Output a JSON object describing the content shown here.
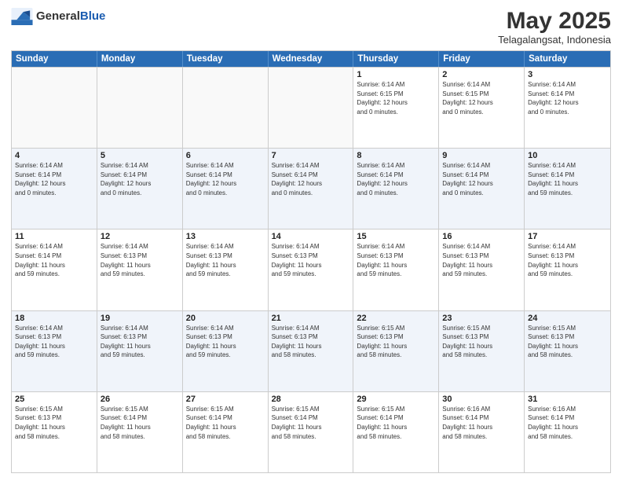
{
  "header": {
    "logo_general": "General",
    "logo_blue": "Blue",
    "title": "May 2025",
    "location": "Telagalangsat, Indonesia"
  },
  "days_of_week": [
    "Sunday",
    "Monday",
    "Tuesday",
    "Wednesday",
    "Thursday",
    "Friday",
    "Saturday"
  ],
  "weeks": [
    [
      {
        "day": "",
        "info": "",
        "empty": true
      },
      {
        "day": "",
        "info": "",
        "empty": true
      },
      {
        "day": "",
        "info": "",
        "empty": true
      },
      {
        "day": "",
        "info": "",
        "empty": true
      },
      {
        "day": "1",
        "info": "Sunrise: 6:14 AM\nSunset: 6:15 PM\nDaylight: 12 hours\nand 0 minutes.",
        "empty": false
      },
      {
        "day": "2",
        "info": "Sunrise: 6:14 AM\nSunset: 6:15 PM\nDaylight: 12 hours\nand 0 minutes.",
        "empty": false
      },
      {
        "day": "3",
        "info": "Sunrise: 6:14 AM\nSunset: 6:14 PM\nDaylight: 12 hours\nand 0 minutes.",
        "empty": false
      }
    ],
    [
      {
        "day": "4",
        "info": "Sunrise: 6:14 AM\nSunset: 6:14 PM\nDaylight: 12 hours\nand 0 minutes.",
        "empty": false
      },
      {
        "day": "5",
        "info": "Sunrise: 6:14 AM\nSunset: 6:14 PM\nDaylight: 12 hours\nand 0 minutes.",
        "empty": false
      },
      {
        "day": "6",
        "info": "Sunrise: 6:14 AM\nSunset: 6:14 PM\nDaylight: 12 hours\nand 0 minutes.",
        "empty": false
      },
      {
        "day": "7",
        "info": "Sunrise: 6:14 AM\nSunset: 6:14 PM\nDaylight: 12 hours\nand 0 minutes.",
        "empty": false
      },
      {
        "day": "8",
        "info": "Sunrise: 6:14 AM\nSunset: 6:14 PM\nDaylight: 12 hours\nand 0 minutes.",
        "empty": false
      },
      {
        "day": "9",
        "info": "Sunrise: 6:14 AM\nSunset: 6:14 PM\nDaylight: 12 hours\nand 0 minutes.",
        "empty": false
      },
      {
        "day": "10",
        "info": "Sunrise: 6:14 AM\nSunset: 6:14 PM\nDaylight: 11 hours\nand 59 minutes.",
        "empty": false
      }
    ],
    [
      {
        "day": "11",
        "info": "Sunrise: 6:14 AM\nSunset: 6:14 PM\nDaylight: 11 hours\nand 59 minutes.",
        "empty": false
      },
      {
        "day": "12",
        "info": "Sunrise: 6:14 AM\nSunset: 6:13 PM\nDaylight: 11 hours\nand 59 minutes.",
        "empty": false
      },
      {
        "day": "13",
        "info": "Sunrise: 6:14 AM\nSunset: 6:13 PM\nDaylight: 11 hours\nand 59 minutes.",
        "empty": false
      },
      {
        "day": "14",
        "info": "Sunrise: 6:14 AM\nSunset: 6:13 PM\nDaylight: 11 hours\nand 59 minutes.",
        "empty": false
      },
      {
        "day": "15",
        "info": "Sunrise: 6:14 AM\nSunset: 6:13 PM\nDaylight: 11 hours\nand 59 minutes.",
        "empty": false
      },
      {
        "day": "16",
        "info": "Sunrise: 6:14 AM\nSunset: 6:13 PM\nDaylight: 11 hours\nand 59 minutes.",
        "empty": false
      },
      {
        "day": "17",
        "info": "Sunrise: 6:14 AM\nSunset: 6:13 PM\nDaylight: 11 hours\nand 59 minutes.",
        "empty": false
      }
    ],
    [
      {
        "day": "18",
        "info": "Sunrise: 6:14 AM\nSunset: 6:13 PM\nDaylight: 11 hours\nand 59 minutes.",
        "empty": false
      },
      {
        "day": "19",
        "info": "Sunrise: 6:14 AM\nSunset: 6:13 PM\nDaylight: 11 hours\nand 59 minutes.",
        "empty": false
      },
      {
        "day": "20",
        "info": "Sunrise: 6:14 AM\nSunset: 6:13 PM\nDaylight: 11 hours\nand 59 minutes.",
        "empty": false
      },
      {
        "day": "21",
        "info": "Sunrise: 6:14 AM\nSunset: 6:13 PM\nDaylight: 11 hours\nand 58 minutes.",
        "empty": false
      },
      {
        "day": "22",
        "info": "Sunrise: 6:15 AM\nSunset: 6:13 PM\nDaylight: 11 hours\nand 58 minutes.",
        "empty": false
      },
      {
        "day": "23",
        "info": "Sunrise: 6:15 AM\nSunset: 6:13 PM\nDaylight: 11 hours\nand 58 minutes.",
        "empty": false
      },
      {
        "day": "24",
        "info": "Sunrise: 6:15 AM\nSunset: 6:13 PM\nDaylight: 11 hours\nand 58 minutes.",
        "empty": false
      }
    ],
    [
      {
        "day": "25",
        "info": "Sunrise: 6:15 AM\nSunset: 6:13 PM\nDaylight: 11 hours\nand 58 minutes.",
        "empty": false
      },
      {
        "day": "26",
        "info": "Sunrise: 6:15 AM\nSunset: 6:14 PM\nDaylight: 11 hours\nand 58 minutes.",
        "empty": false
      },
      {
        "day": "27",
        "info": "Sunrise: 6:15 AM\nSunset: 6:14 PM\nDaylight: 11 hours\nand 58 minutes.",
        "empty": false
      },
      {
        "day": "28",
        "info": "Sunrise: 6:15 AM\nSunset: 6:14 PM\nDaylight: 11 hours\nand 58 minutes.",
        "empty": false
      },
      {
        "day": "29",
        "info": "Sunrise: 6:15 AM\nSunset: 6:14 PM\nDaylight: 11 hours\nand 58 minutes.",
        "empty": false
      },
      {
        "day": "30",
        "info": "Sunrise: 6:16 AM\nSunset: 6:14 PM\nDaylight: 11 hours\nand 58 minutes.",
        "empty": false
      },
      {
        "day": "31",
        "info": "Sunrise: 6:16 AM\nSunset: 6:14 PM\nDaylight: 11 hours\nand 58 minutes.",
        "empty": false
      }
    ]
  ]
}
